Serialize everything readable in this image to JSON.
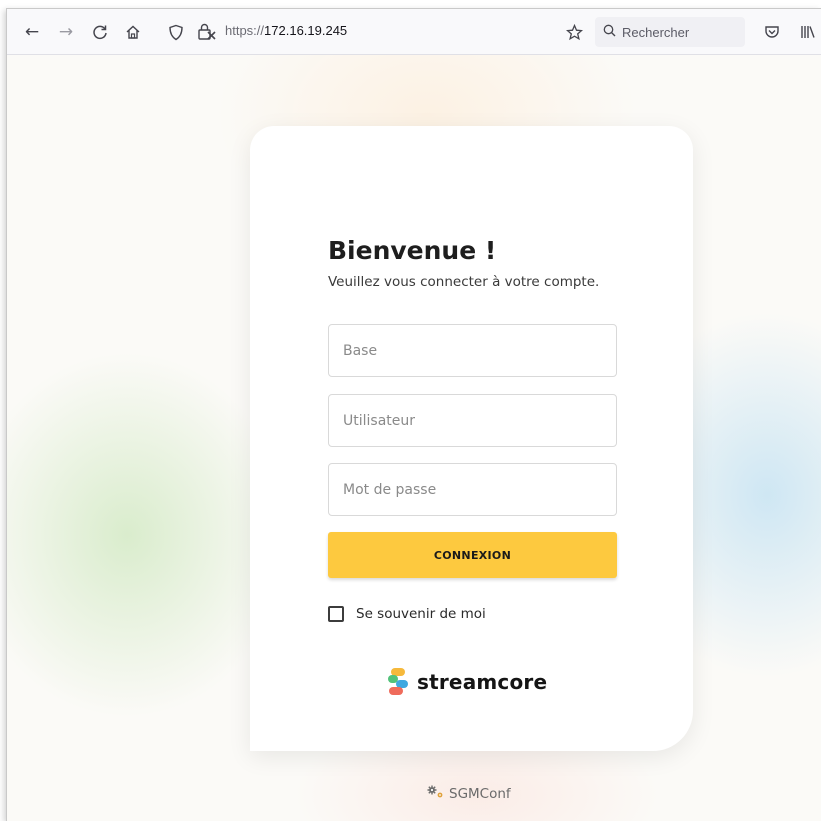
{
  "browser": {
    "url_prefix": "https://",
    "url_host": "172.16.19.245",
    "search_placeholder": "Rechercher",
    "icons": {
      "back": "back-arrow-icon",
      "forward": "forward-arrow-icon",
      "reload": "reload-icon",
      "home": "home-icon",
      "shield": "tracking-shield-icon",
      "lock": "insecure-lock-icon",
      "bookmark": "bookmark-star-icon",
      "search": "search-icon",
      "pocket": "pocket-icon",
      "library": "library-icon"
    }
  },
  "login": {
    "title": "Bienvenue !",
    "subtitle": "Veuillez vous connecter à votre compte.",
    "base_placeholder": "Base",
    "user_placeholder": "Utilisateur",
    "password_placeholder": "Mot de passe",
    "submit_label": "CONNEXION",
    "remember_label": "Se souvenir de moi",
    "remember_checked": false,
    "button_color": "#fdc93f"
  },
  "brand": {
    "logo_text": "streamcore",
    "logo_colors": [
      "#f6b93b",
      "#52c27a",
      "#3fa8e0",
      "#ef6b5b"
    ]
  },
  "footer": {
    "text": "SGMConf",
    "icon": "gears-icon"
  }
}
